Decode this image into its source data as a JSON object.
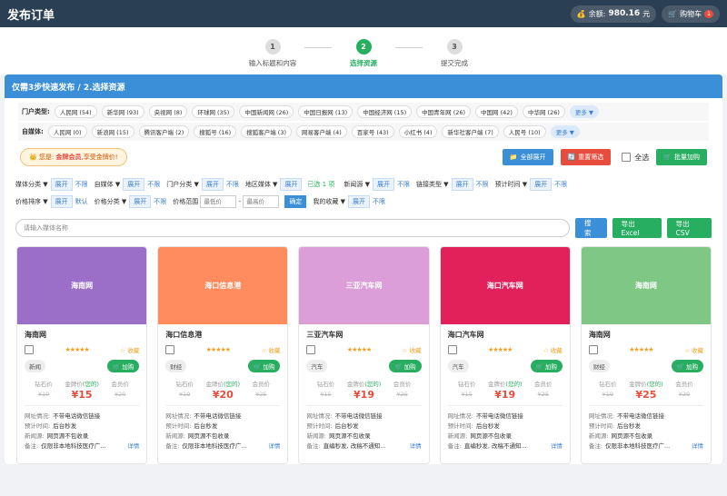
{
  "header": {
    "title": "发布订单",
    "balance_label": "余额:",
    "balance_value": "980.16",
    "balance_unit": "元",
    "cart_label": "购物车",
    "cart_count": "1"
  },
  "steps": [
    {
      "num": "1",
      "label": "输入标题和内容"
    },
    {
      "num": "2",
      "label": "选择资源"
    },
    {
      "num": "3",
      "label": "提交完成"
    }
  ],
  "banner": "仅需3步快速发布 / 2.选择资源",
  "portal": {
    "caption": "门户类型:",
    "tags": [
      "人民网 (54)",
      "新华网 (93)",
      "央视网 (8)",
      "环球网 (35)",
      "中国新闻网 (26)",
      "中国日报网 (13)",
      "中国经济网 (15)",
      "中国青年网 (26)",
      "中国网 (42)",
      "中华网 (26)"
    ],
    "more": "更多 ▼"
  },
  "selfmedia": {
    "caption": "自媒体:",
    "tags": [
      "人民网 (0)",
      "新浪网 (15)",
      "腾讯客户端 (2)",
      "搜狐号 (16)",
      "搜狐客户端 (3)",
      "网易客户端 (4)",
      "百家号 (43)",
      "小红书 (4)",
      "新华社客户端 (7)",
      "人民号 (10)"
    ],
    "more": "更多 ▼"
  },
  "vip": {
    "prefix": "您是:",
    "level": "金牌会员",
    "suffix": ",享受金牌价!"
  },
  "actions": {
    "expand_all": "全部展开",
    "reset": "重置筛选",
    "select_all": "全选",
    "bulk_add": "批量加购"
  },
  "filters": {
    "expand": "展开",
    "nolimit": "不限",
    "media_cat": "媒体分类",
    "self_media": "自媒体",
    "portal_cat": "门户分类",
    "region": "地区媒体",
    "selected": "已选 1 项",
    "news_src": "新闻源",
    "link_type": "链接类型",
    "eta": "预计时间",
    "price_sort": "价格排序",
    "default": "默认",
    "price_cat": "价格分类",
    "price_range": "价格范围",
    "min_ph": "最低价",
    "max_ph": "最高价",
    "confirm": "确定",
    "my_fav": "我的收藏"
  },
  "search": {
    "placeholder": "请输入媒体名称",
    "search_btn": "搜索",
    "excel_btn": "导出Excel",
    "csv_btn": "导出CSV"
  },
  "card_labels": {
    "fav": "☆ 收藏",
    "add": "加购",
    "diamond": "钻石价",
    "gold": "金牌价",
    "gold_mine": "(您的)",
    "silver": "会员价",
    "site": "网址情况:",
    "time": "预计时间:",
    "src": "新闻源:",
    "note": "备注:",
    "detail": "详情",
    "stars": "★★★★★"
  },
  "cards": [
    {
      "name": "海南网",
      "color": "#9b6ec8",
      "category": "新闻",
      "diamond": "¥10",
      "gold": "¥15",
      "silver": "¥20",
      "site": "不带电话微信链接",
      "time": "后台秒发",
      "src": "网页源不包收录",
      "note": "仅限非本地科技医疗广..."
    },
    {
      "name": "海口信息港",
      "color": "#fe8c5e",
      "category": "财经",
      "diamond": "¥19",
      "gold": "¥20",
      "silver": "¥25",
      "site": "不带电话微信链接",
      "time": "后台秒发",
      "src": "网页源不包收录",
      "note": "仅限非本地科技医疗广..."
    },
    {
      "name": "三亚汽车网",
      "color": "#dc9ed8",
      "category": "汽车",
      "diamond": "¥15",
      "gold": "¥19",
      "silver": "¥25",
      "site": "不带电话微信链接",
      "time": "后台秒发",
      "src": "网页源不包收录",
      "note": "直编秒发, 改稿不通知..."
    },
    {
      "name": "海口汽车网",
      "color": "#e2215a",
      "category": "汽车",
      "diamond": "¥15",
      "gold": "¥19",
      "silver": "¥25",
      "site": "不带电话微信链接",
      "time": "后台秒发",
      "src": "网页源不包收录",
      "note": "直编秒发, 改稿不通知..."
    },
    {
      "name": "海南网",
      "color": "#7ec785",
      "category": "财经",
      "diamond": "¥19",
      "gold": "¥25",
      "silver": "¥29",
      "site": "不带电话微信链接",
      "time": "后台秒发",
      "src": "网页源不包收录",
      "note": "仅限非本地科技医疗广..."
    }
  ]
}
